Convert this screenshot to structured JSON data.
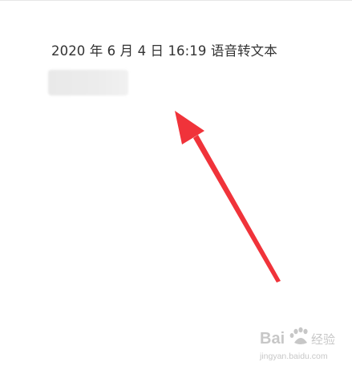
{
  "note": {
    "header_text": "2020 年 6 月 4 日 16:19 语音转文本"
  },
  "annotation": {
    "arrow_color": "#f0333a"
  },
  "watermark": {
    "brand": "Baidu 经验",
    "url": "jingyan.baidu.com",
    "color": "#9a9a9a"
  }
}
